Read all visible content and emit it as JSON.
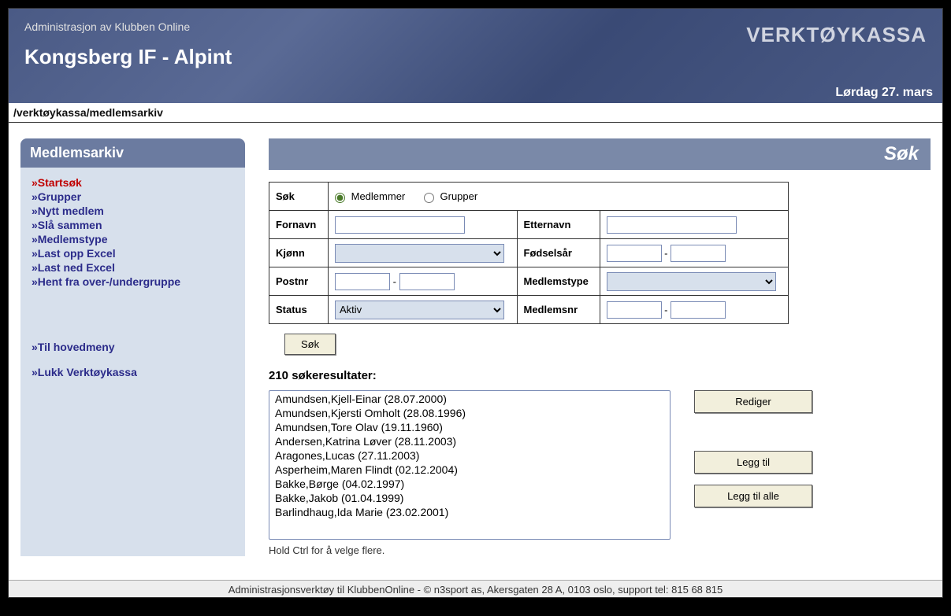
{
  "banner": {
    "admin_label": "Administrasjon av Klubben Online",
    "club_title": "Kongsberg IF - Alpint",
    "logo_text": "VERKTØYKASSA",
    "date_line": "Lørdag 27. mars"
  },
  "breadcrumb": "/verktøykassa/medlemsarkiv",
  "sidebar": {
    "title": "Medlemsarkiv",
    "items": [
      {
        "label": "»Startsøk",
        "active": true
      },
      {
        "label": "»Grupper"
      },
      {
        "label": "»Nytt medlem"
      },
      {
        "label": "»Slå sammen"
      },
      {
        "label": "»Medlemstype"
      },
      {
        "label": "»Last opp Excel"
      },
      {
        "label": "»Last ned Excel"
      },
      {
        "label": "»Hent fra over-/undergruppe"
      }
    ],
    "items2": [
      {
        "label": "»Til hovedmeny"
      },
      {
        "label": "»Lukk Verktøykassa"
      }
    ],
    "data_names": [
      "nav-startsok",
      "nav-grupper",
      "nav-nytt-medlem",
      "nav-sla-sammen",
      "nav-medlemstype",
      "nav-last-opp-excel",
      "nav-last-ned-excel",
      "nav-hent-fra-gruppe"
    ],
    "data_names2": [
      "nav-til-hovedmeny",
      "nav-lukk-verktoykassa"
    ]
  },
  "panel": {
    "title": "Søk",
    "search": {
      "label_sok": "Søk",
      "radio_medlemmer": "Medlemmer",
      "radio_grupper": "Grupper",
      "label_fornavn": "Fornavn",
      "label_etternavn": "Etternavn",
      "label_kjonn": "Kjønn",
      "label_fodselsar": "Fødselsår",
      "label_postnr": "Postnr",
      "label_medlemstype": "Medlemstype",
      "label_status": "Status",
      "status_value": "Aktiv",
      "label_medlemsnr": "Medlemsnr",
      "btn_sok": "Søk",
      "range_sep": "-"
    },
    "results_count": "210 søkeresultater:",
    "results": [
      "Amundsen,Kjell-Einar (28.07.2000)",
      "Amundsen,Kjersti Omholt (28.08.1996)",
      "Amundsen,Tore Olav (19.11.1960)",
      "Andersen,Katrina Løver (28.11.2003)",
      "Aragones,Lucas (27.11.2003)",
      "Asperheim,Maren Flindt (02.12.2004)",
      "Bakke,Børge (04.02.1997)",
      "Bakke,Jakob (01.04.1999)",
      "Barlindhaug,Ida Marie (23.02.2001)"
    ],
    "btn_rediger": "Rediger",
    "btn_leggtil": "Legg til",
    "btn_leggtilalle": "Legg til alle",
    "hint": "Hold Ctrl for å velge flere."
  },
  "footer": "Administrasjonsverktøy til KlubbenOnline - © n3sport as, Akersgaten 28 A, 0103 oslo, support tel: 815 68 815"
}
